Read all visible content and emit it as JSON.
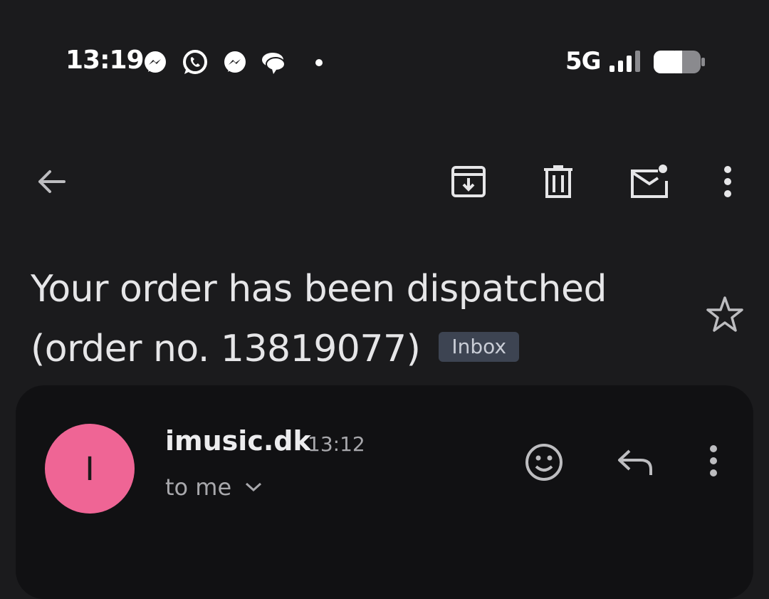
{
  "status_bar": {
    "time": "13:19",
    "network": "5G",
    "notification_icons": [
      "messenger-icon",
      "whatsapp-icon",
      "messenger-icon",
      "chat-bubbles-icon",
      "dot-icon"
    ]
  },
  "toolbar": {
    "icons": [
      "back-arrow-icon",
      "archive-icon",
      "delete-icon",
      "mark-unread-icon",
      "more-vert-icon"
    ]
  },
  "email": {
    "subject": "Your order has been dispatched (order no. 13819077)",
    "label": "Inbox",
    "sender": {
      "initial": "I",
      "name": "imusic.dk",
      "time": "13:12",
      "recipients": "to me",
      "avatar_color": "#ef6595"
    }
  },
  "colors": {
    "background": "#1b1b1d",
    "card": "#111113",
    "chip": "#3d4452"
  }
}
